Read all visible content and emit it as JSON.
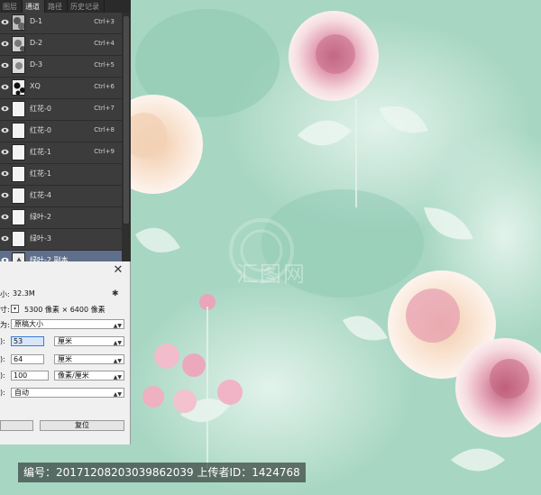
{
  "panel": {
    "tabs": [
      {
        "label": "图层",
        "active": false
      },
      {
        "label": "通道",
        "active": true
      },
      {
        "label": "路径",
        "active": false
      },
      {
        "label": "历史记录",
        "active": false
      }
    ],
    "channels": [
      {
        "name": "D-1",
        "shortcut": "Ctrl+3"
      },
      {
        "name": "D-2",
        "shortcut": "Ctrl+4"
      },
      {
        "name": "D-3",
        "shortcut": "Ctrl+5"
      },
      {
        "name": "XQ",
        "shortcut": "Ctrl+6"
      },
      {
        "name": "红花-0",
        "shortcut": "Ctrl+7"
      },
      {
        "name": "红花-0",
        "shortcut": "Ctrl+8"
      },
      {
        "name": "红花-1",
        "shortcut": "Ctrl+9"
      },
      {
        "name": "红花-1",
        "shortcut": ""
      },
      {
        "name": "红花-4",
        "shortcut": ""
      },
      {
        "name": "绿叶-2",
        "shortcut": ""
      },
      {
        "name": "绿叶-3",
        "shortcut": ""
      },
      {
        "name": "绿叶-2 副本",
        "shortcut": "",
        "selected": true
      }
    ]
  },
  "dialog": {
    "close_label": "✕",
    "size_label": "小:",
    "size_value": "32.3M",
    "dims_label": "寸:",
    "dims_value": "5300 像素 × 6400 像素",
    "fit_label": "为:",
    "fit_value": "原稿大小",
    "width_label": "):",
    "width_value": "53",
    "width_unit": "厘米",
    "height_label": "):",
    "height_value": "64",
    "height_unit": "厘米",
    "res_label": "):",
    "res_value": "100",
    "res_unit": "像素/厘米",
    "resample_label": "):",
    "resample_value": "自动",
    "reset_label": "复位"
  },
  "watermark": {
    "text": "汇图网"
  },
  "info_bar": {
    "text": "编号：20171208203039862039 上传者ID：1424768"
  }
}
